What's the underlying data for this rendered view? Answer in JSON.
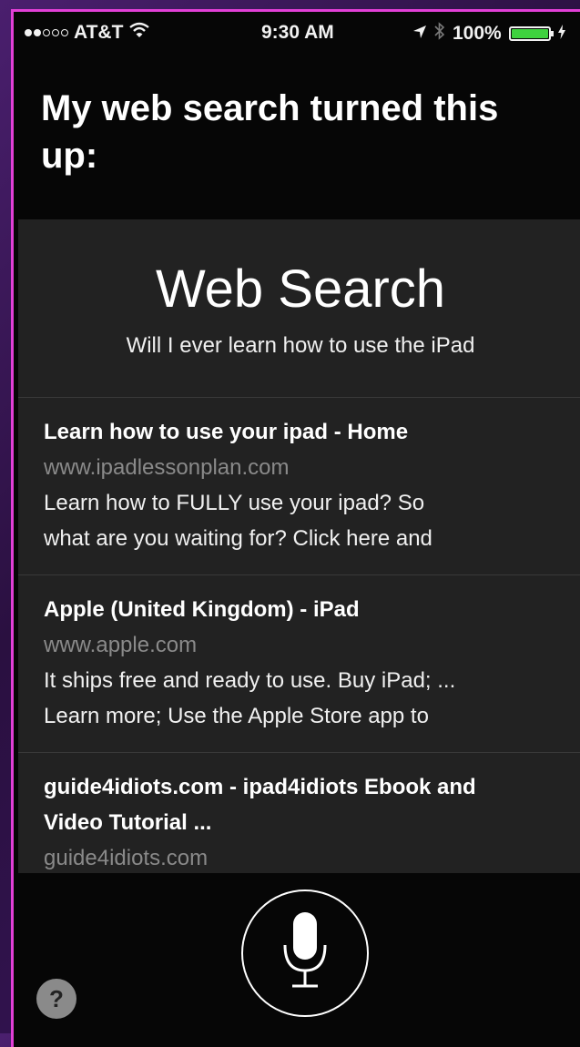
{
  "status_bar": {
    "signal_filled": 2,
    "signal_total": 5,
    "carrier": "AT&T",
    "time": "9:30 AM",
    "battery_percent_label": "100%",
    "battery_level": 1.0,
    "icons": [
      "wifi-icon",
      "location-arrow-icon",
      "bluetooth-icon",
      "battery-icon",
      "charging-icon"
    ]
  },
  "siri": {
    "heading": "My web search turned this up:"
  },
  "card": {
    "title": "Web Search",
    "query": "Will I ever learn how to use the iPad",
    "results": [
      {
        "title": "Learn how to use your ipad - Home",
        "url": "www.ipadlessonplan.com",
        "snippet": "Learn how to FULLY use your ipad? So\nwhat are you waiting for? Click here and"
      },
      {
        "title": "Apple (United Kingdom) - iPad",
        "url": "www.apple.com",
        "snippet": "It ships free and ready to use. Buy iPad; ...\nLearn more; Use the Apple Store app to"
      },
      {
        "title": "guide4idiots.com - ipad4idiots Ebook and\nVideo Tutorial ...",
        "url": "guide4idiots.com",
        "snippet": ""
      }
    ]
  },
  "bottom": {
    "mic_icon": "microphone-icon",
    "help_label": "?"
  },
  "colors": {
    "frame_border": "#e23fd6",
    "background": "#060606",
    "card": "#222222",
    "battery_fill": "#3ed23e",
    "url_text": "#8a8a8a"
  }
}
